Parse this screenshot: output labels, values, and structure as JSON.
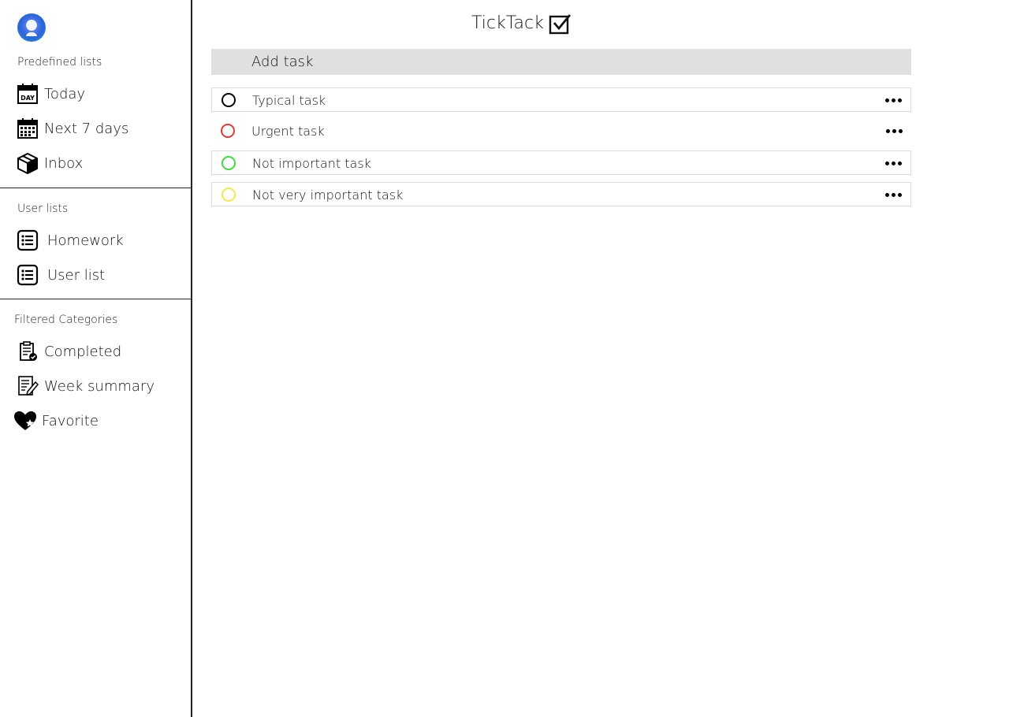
{
  "app": {
    "title": "TickTack"
  },
  "sidebar": {
    "predefined_title": "Predefined lists",
    "predefined": [
      {
        "label": "Today",
        "icon": "calendar-day-icon"
      },
      {
        "label": "Next 7 days",
        "icon": "calendar-week-icon"
      },
      {
        "label": "Inbox",
        "icon": "box-icon"
      }
    ],
    "user_title": "User lists",
    "user": [
      {
        "label": "Homework",
        "icon": "list-icon"
      },
      {
        "label": "User list",
        "icon": "list-icon"
      }
    ],
    "filtered_title": "Filtered Categories",
    "filtered": [
      {
        "label": "Completed",
        "icon": "clipboard-check-icon"
      },
      {
        "label": "Week summary",
        "icon": "document-edit-icon"
      },
      {
        "label": "Favorite",
        "icon": "heart-star-icon"
      }
    ]
  },
  "main": {
    "add_task_label": "Add task",
    "tasks": [
      {
        "name": "Typical task",
        "priority_color": "#000000"
      },
      {
        "name": "Urgent task",
        "priority_color": "#e53935"
      },
      {
        "name": "Not important task",
        "priority_color": "#3ddc3d"
      },
      {
        "name": "Not very important task",
        "priority_color": "#f5e94a"
      }
    ]
  }
}
